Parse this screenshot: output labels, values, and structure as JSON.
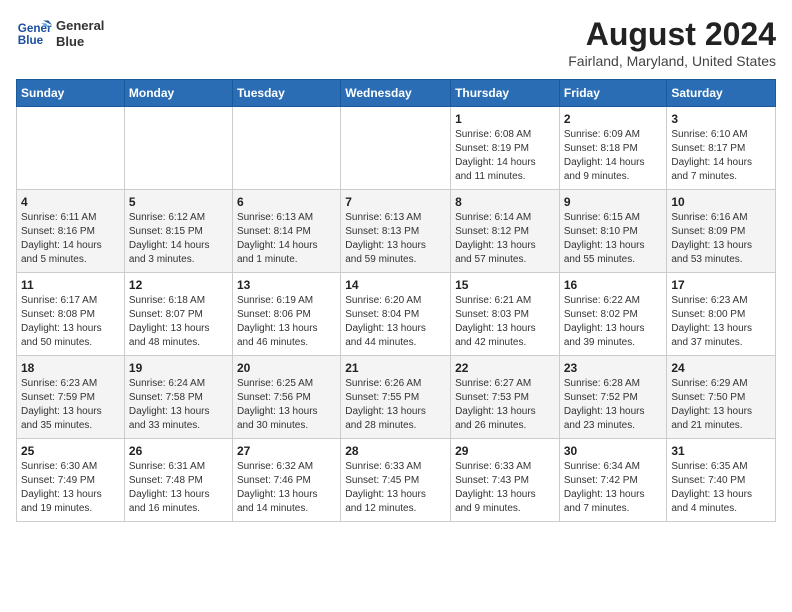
{
  "header": {
    "logo_line1": "General",
    "logo_line2": "Blue",
    "month": "August 2024",
    "location": "Fairland, Maryland, United States"
  },
  "days_of_week": [
    "Sunday",
    "Monday",
    "Tuesday",
    "Wednesday",
    "Thursday",
    "Friday",
    "Saturday"
  ],
  "weeks": [
    [
      {
        "day": "",
        "info": ""
      },
      {
        "day": "",
        "info": ""
      },
      {
        "day": "",
        "info": ""
      },
      {
        "day": "",
        "info": ""
      },
      {
        "day": "1",
        "info": "Sunrise: 6:08 AM\nSunset: 8:19 PM\nDaylight: 14 hours\nand 11 minutes."
      },
      {
        "day": "2",
        "info": "Sunrise: 6:09 AM\nSunset: 8:18 PM\nDaylight: 14 hours\nand 9 minutes."
      },
      {
        "day": "3",
        "info": "Sunrise: 6:10 AM\nSunset: 8:17 PM\nDaylight: 14 hours\nand 7 minutes."
      }
    ],
    [
      {
        "day": "4",
        "info": "Sunrise: 6:11 AM\nSunset: 8:16 PM\nDaylight: 14 hours\nand 5 minutes."
      },
      {
        "day": "5",
        "info": "Sunrise: 6:12 AM\nSunset: 8:15 PM\nDaylight: 14 hours\nand 3 minutes."
      },
      {
        "day": "6",
        "info": "Sunrise: 6:13 AM\nSunset: 8:14 PM\nDaylight: 14 hours\nand 1 minute."
      },
      {
        "day": "7",
        "info": "Sunrise: 6:13 AM\nSunset: 8:13 PM\nDaylight: 13 hours\nand 59 minutes."
      },
      {
        "day": "8",
        "info": "Sunrise: 6:14 AM\nSunset: 8:12 PM\nDaylight: 13 hours\nand 57 minutes."
      },
      {
        "day": "9",
        "info": "Sunrise: 6:15 AM\nSunset: 8:10 PM\nDaylight: 13 hours\nand 55 minutes."
      },
      {
        "day": "10",
        "info": "Sunrise: 6:16 AM\nSunset: 8:09 PM\nDaylight: 13 hours\nand 53 minutes."
      }
    ],
    [
      {
        "day": "11",
        "info": "Sunrise: 6:17 AM\nSunset: 8:08 PM\nDaylight: 13 hours\nand 50 minutes."
      },
      {
        "day": "12",
        "info": "Sunrise: 6:18 AM\nSunset: 8:07 PM\nDaylight: 13 hours\nand 48 minutes."
      },
      {
        "day": "13",
        "info": "Sunrise: 6:19 AM\nSunset: 8:06 PM\nDaylight: 13 hours\nand 46 minutes."
      },
      {
        "day": "14",
        "info": "Sunrise: 6:20 AM\nSunset: 8:04 PM\nDaylight: 13 hours\nand 44 minutes."
      },
      {
        "day": "15",
        "info": "Sunrise: 6:21 AM\nSunset: 8:03 PM\nDaylight: 13 hours\nand 42 minutes."
      },
      {
        "day": "16",
        "info": "Sunrise: 6:22 AM\nSunset: 8:02 PM\nDaylight: 13 hours\nand 39 minutes."
      },
      {
        "day": "17",
        "info": "Sunrise: 6:23 AM\nSunset: 8:00 PM\nDaylight: 13 hours\nand 37 minutes."
      }
    ],
    [
      {
        "day": "18",
        "info": "Sunrise: 6:23 AM\nSunset: 7:59 PM\nDaylight: 13 hours\nand 35 minutes."
      },
      {
        "day": "19",
        "info": "Sunrise: 6:24 AM\nSunset: 7:58 PM\nDaylight: 13 hours\nand 33 minutes."
      },
      {
        "day": "20",
        "info": "Sunrise: 6:25 AM\nSunset: 7:56 PM\nDaylight: 13 hours\nand 30 minutes."
      },
      {
        "day": "21",
        "info": "Sunrise: 6:26 AM\nSunset: 7:55 PM\nDaylight: 13 hours\nand 28 minutes."
      },
      {
        "day": "22",
        "info": "Sunrise: 6:27 AM\nSunset: 7:53 PM\nDaylight: 13 hours\nand 26 minutes."
      },
      {
        "day": "23",
        "info": "Sunrise: 6:28 AM\nSunset: 7:52 PM\nDaylight: 13 hours\nand 23 minutes."
      },
      {
        "day": "24",
        "info": "Sunrise: 6:29 AM\nSunset: 7:50 PM\nDaylight: 13 hours\nand 21 minutes."
      }
    ],
    [
      {
        "day": "25",
        "info": "Sunrise: 6:30 AM\nSunset: 7:49 PM\nDaylight: 13 hours\nand 19 minutes."
      },
      {
        "day": "26",
        "info": "Sunrise: 6:31 AM\nSunset: 7:48 PM\nDaylight: 13 hours\nand 16 minutes."
      },
      {
        "day": "27",
        "info": "Sunrise: 6:32 AM\nSunset: 7:46 PM\nDaylight: 13 hours\nand 14 minutes."
      },
      {
        "day": "28",
        "info": "Sunrise: 6:33 AM\nSunset: 7:45 PM\nDaylight: 13 hours\nand 12 minutes."
      },
      {
        "day": "29",
        "info": "Sunrise: 6:33 AM\nSunset: 7:43 PM\nDaylight: 13 hours\nand 9 minutes."
      },
      {
        "day": "30",
        "info": "Sunrise: 6:34 AM\nSunset: 7:42 PM\nDaylight: 13 hours\nand 7 minutes."
      },
      {
        "day": "31",
        "info": "Sunrise: 6:35 AM\nSunset: 7:40 PM\nDaylight: 13 hours\nand 4 minutes."
      }
    ]
  ]
}
